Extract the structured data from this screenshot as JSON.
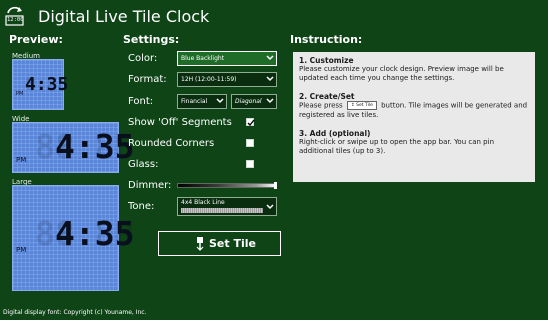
{
  "app": {
    "title": "Digital Live Tile Clock",
    "icon": "clock-refresh-icon",
    "icon_text": "12:00"
  },
  "preview": {
    "heading": "Preview:",
    "tiles": [
      {
        "label": "Medium",
        "time": "4:35",
        "ghost": "8:88",
        "ampm": "PM"
      },
      {
        "label": "Wide",
        "time": "4:35",
        "ghost": "88:88",
        "ampm": "PM"
      },
      {
        "label": "Large",
        "time": "4:35",
        "ghost": "88:88",
        "ampm": "PM"
      }
    ]
  },
  "settings": {
    "heading": "Settings:",
    "color": {
      "label": "Color:",
      "value": "Blue Backlight"
    },
    "format": {
      "label": "Format:",
      "value": "12H (12:00-11:59)"
    },
    "font": {
      "label": "Font:",
      "value": "Financial",
      "style_value": "Diagonal"
    },
    "show_off_segments": {
      "label": "Show 'Off' Segments",
      "checked": true
    },
    "rounded_corners": {
      "label": "Rounded Corners",
      "checked": false
    },
    "glass": {
      "label": "Glass:",
      "checked": false
    },
    "dimmer": {
      "label": "Dimmer:",
      "level_fraction": 1.0
    },
    "tone": {
      "label": "Tone:",
      "value": "4x4 Black Line"
    },
    "set_tile_button": {
      "label": "Set Tile",
      "icon": "pin-icon"
    }
  },
  "instruction": {
    "heading": "Instruction:",
    "steps": [
      {
        "title": "1. Customize",
        "text": "Please customize your clock design. Preview image will be updated each time you change the settings."
      },
      {
        "title": "2. Create/Set",
        "text_before": "Please press",
        "button_text": "Set Tile",
        "text_after": "button. Tile images will be generated and registered as live tiles."
      },
      {
        "title": "3. Add (optional)",
        "text": "Right-click or swipe up to open the app bar. You can pin additional tiles (up to 3)."
      }
    ]
  },
  "footer": {
    "text": "Digital display font: Copyright (c) Youname, Inc."
  },
  "colors": {
    "background": "#0f4417",
    "tile_blue": "#5a86d9",
    "panel": "#e9e9e9",
    "select_open": "#1f6b28"
  }
}
